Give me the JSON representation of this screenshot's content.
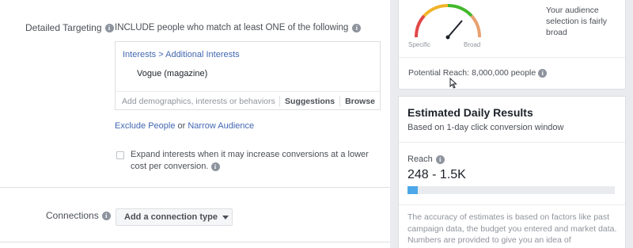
{
  "targeting": {
    "label": "Detailed Targeting",
    "include_text": "INCLUDE people who match at least ONE of the following",
    "breadcrumb": "Interests > Additional Interests",
    "selected_interest": "Vogue (magazine)",
    "input_placeholder": "Add demographics, interests or behaviors",
    "suggestions_label": "Suggestions",
    "browse_label": "Browse",
    "exclude_link": "Exclude People",
    "or_text": "or",
    "narrow_link": "Narrow Audience",
    "expand_text": "Expand interests when it may increase conversions at a lower cost per conversion."
  },
  "connections": {
    "label": "Connections",
    "dropdown_label": "Add a connection type"
  },
  "audience": {
    "gauge_specific": "Specific",
    "gauge_broad": "Broad",
    "description": "Your audience selection is fairly broad",
    "potential_reach_label": "Potential Reach:",
    "potential_reach_value": "8,000,000 people"
  },
  "estimated": {
    "title": "Estimated Daily Results",
    "subtitle": "Based on 1-day click conversion window",
    "reach_label": "Reach",
    "reach_value": "248 - 1.5K",
    "reach_fill": 0.05,
    "disclaimer": "The accuracy of estimates is based on factors like past campaign data, the budget you entered and market data. Numbers are provided to give you an idea of"
  },
  "colors": {
    "link": "#4267b2",
    "reach_bar": "#4ca8e8"
  },
  "icons": {
    "info": "info-circle-icon",
    "caret": "caret-down-icon",
    "cursor": "mouse-pointer-icon"
  }
}
